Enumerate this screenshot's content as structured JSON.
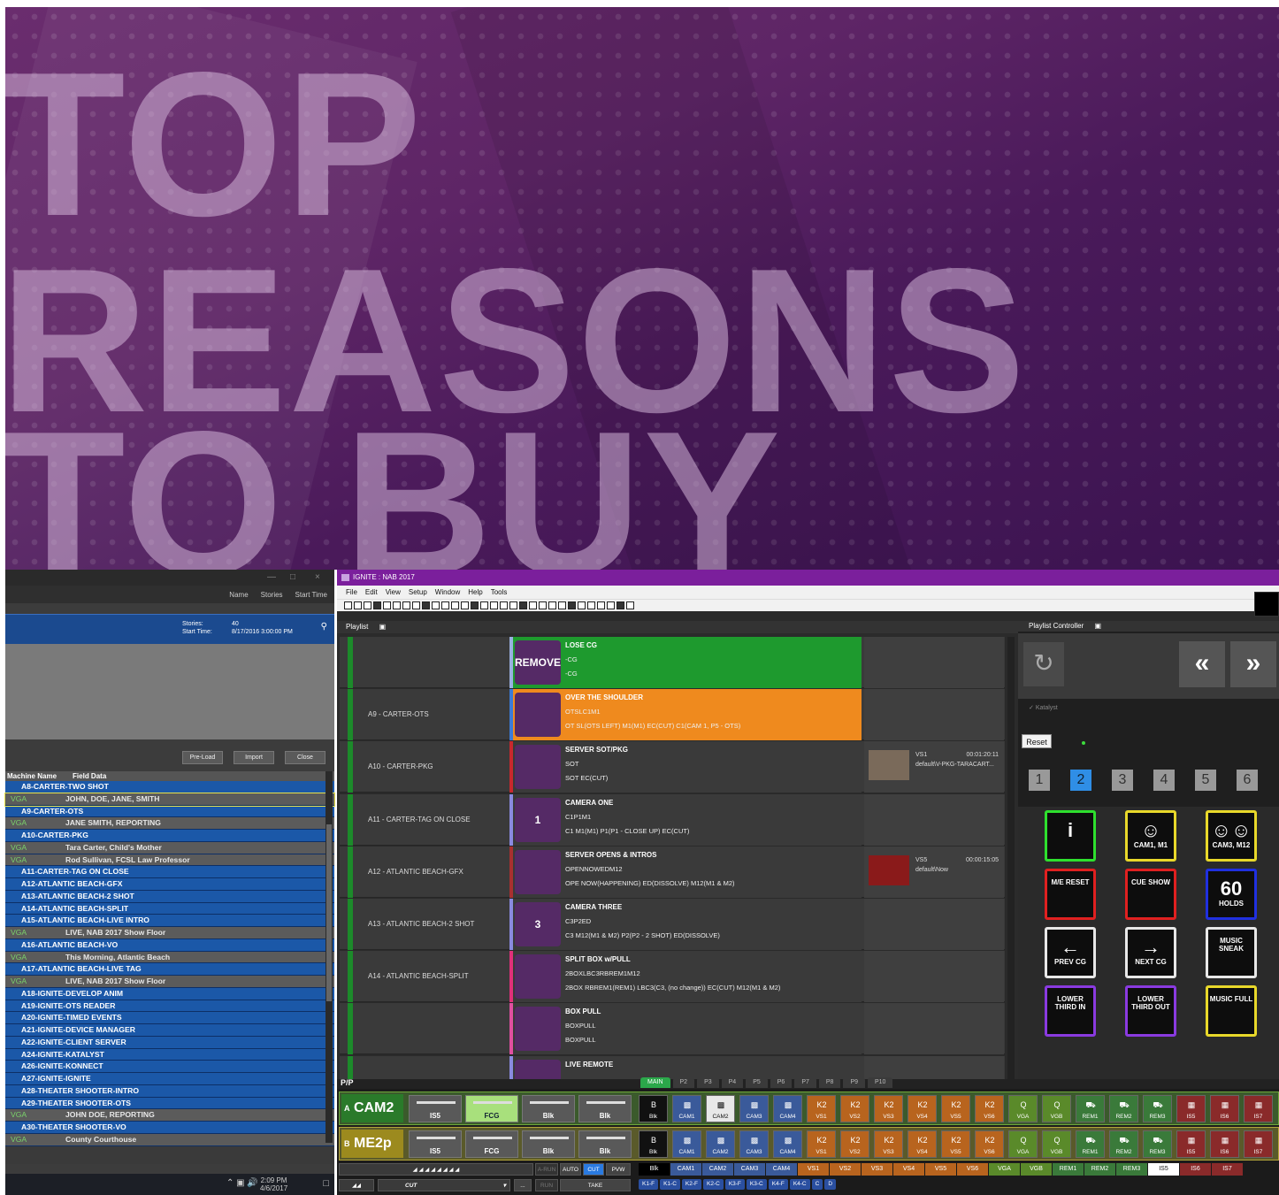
{
  "banner": {
    "line1": "TOP",
    "line2": "REASONS",
    "line3": "TO BUY"
  },
  "left": {
    "win_controls": [
      "—",
      "□",
      "×"
    ],
    "header_cols": [
      "Name",
      "Stories",
      "Start Time"
    ],
    "selected": {
      "stories_label": "Stories:",
      "stories_value": "40",
      "start_label": "Start Time:",
      "start_value": "8/17/2016 3:00:00 PM"
    },
    "buttons": {
      "preload": "Pre-Load",
      "import": "Import",
      "close": "Close"
    },
    "columns": {
      "machine": "Machine Name",
      "field": "Field Data"
    },
    "rows": [
      {
        "type": "blue",
        "text": "A8-CARTER-TWO SHOT"
      },
      {
        "type": "grey",
        "tag": "VGA",
        "text": "JOHN, DOE, JANE, SMITH"
      },
      {
        "type": "blue",
        "text": "A9-CARTER-OTS"
      },
      {
        "type": "grey",
        "tag": "VGA",
        "text": "JANE SMITH, REPORTING"
      },
      {
        "type": "blue",
        "text": "A10-CARTER-PKG"
      },
      {
        "type": "grey",
        "tag": "VGA",
        "text": "Tara Carter, Child's Mother"
      },
      {
        "type": "grey",
        "tag": "VGA",
        "text": "Rod Sullivan, FCSL Law Professor"
      },
      {
        "type": "blue",
        "text": "A11-CARTER-TAG ON CLOSE"
      },
      {
        "type": "blue",
        "text": "A12-ATLANTIC BEACH-GFX"
      },
      {
        "type": "blue",
        "text": "A13-ATLANTIC BEACH-2 SHOT"
      },
      {
        "type": "blue",
        "text": "A14-ATLANTIC BEACH-SPLIT"
      },
      {
        "type": "blue",
        "text": "A15-ATLANTIC BEACH-LIVE INTRO"
      },
      {
        "type": "grey",
        "tag": "VGA",
        "text": "LIVE, NAB 2017 Show Floor"
      },
      {
        "type": "blue",
        "text": "A16-ATLANTIC BEACH-VO"
      },
      {
        "type": "grey",
        "tag": "VGA",
        "text": "This Morning, Atlantic Beach"
      },
      {
        "type": "blue",
        "text": "A17-ATLANTIC BEACH-LIVE TAG"
      },
      {
        "type": "grey",
        "tag": "VGA",
        "text": "LIVE, NAB 2017 Show Floor"
      },
      {
        "type": "blue",
        "text": "A18-IGNITE-DEVELOP ANIM"
      },
      {
        "type": "blue",
        "text": "A19-IGNITE-OTS READER"
      },
      {
        "type": "blue",
        "text": "A20-IGNITE-TIMED EVENTS"
      },
      {
        "type": "blue",
        "text": "A21-IGNITE-DEVICE MANAGER"
      },
      {
        "type": "blue",
        "text": "A22-IGNITE-CLIENT SERVER"
      },
      {
        "type": "blue",
        "text": "A24-IGNITE-KATALYST"
      },
      {
        "type": "blue",
        "text": "A26-IGNITE-KONNECT"
      },
      {
        "type": "blue",
        "text": "A27-IGNITE-IGNITE"
      },
      {
        "type": "blue",
        "text": "A28-THEATER SHOOTER-INTRO"
      },
      {
        "type": "blue",
        "text": "A29-THEATER SHOOTER-OTS"
      },
      {
        "type": "grey",
        "tag": "VGA",
        "text": "JOHN DOE, REPORTING"
      },
      {
        "type": "blue",
        "text": "A30-THEATER SHOOTER-VO"
      },
      {
        "type": "grey",
        "tag": "VGA",
        "text": "County Courthouse"
      }
    ],
    "taskbar": {
      "time": "2:09 PM",
      "date": "4/6/2017"
    }
  },
  "main": {
    "title": "IGNITE : NAB 2017",
    "menu": [
      "File",
      "Edit",
      "View",
      "Setup",
      "Window",
      "Help",
      "Tools"
    ],
    "playlist_label": "Playlist",
    "controller_label": "Playlist Controller",
    "katalyst_label": "Katalyst",
    "reset_label": "Reset",
    "numbers": [
      "1",
      "2",
      "3",
      "4",
      "5",
      "6"
    ],
    "active_number": "2",
    "playlist": [
      {
        "name": "",
        "color": "#9ab0e0",
        "bg": "#1e9a2e",
        "icon": "remove-cg-icon",
        "icon_text": "REMOVE CG",
        "t1": "LOSE CG",
        "t2": "-CG",
        "t3": "-CG",
        "side": null
      },
      {
        "name": "A9 - CARTER-OTS",
        "color": "#3a7ad8",
        "bg": "#ef8a1e",
        "icon": "over-shoulder-icon",
        "icon_text": "",
        "t1": "OVER THE SHOULDER",
        "t2": "OTSLC1M1",
        "t3": "OT SL(OTS LEFT) M1(M1) EC(CUT) C1(CAM 1, P5 - OTS)",
        "side": null
      },
      {
        "name": "A10 - CARTER-PKG",
        "color": "#c8282e",
        "bg": "#3a3a3a",
        "icon": "film-reel-icon",
        "icon_text": "",
        "t1": "SERVER SOT/PKG",
        "t2": "SOT",
        "t3": "SOT EC(CUT)",
        "side": {
          "ch": "VS1",
          "dur": "00:01:20:11",
          "clip": "default\\V-PKG-TARACART...",
          "thumb": "#7a6a5a"
        }
      },
      {
        "name": "A11 - CARTER-TAG ON CLOSE",
        "color": "#8a8ae0",
        "bg": "#3a3a3a",
        "icon": "camera-one-icon",
        "icon_text": "1",
        "t1": "CAMERA ONE",
        "t2": "C1P1M1",
        "t3": "C1 M1(M1) P1(P1 - CLOSE UP) EC(CUT)",
        "side": null
      },
      {
        "name": "A12 - ATLANTIC BEACH-GFX",
        "color": "#a83030",
        "bg": "#3a3a3a",
        "icon": "clapper-icon",
        "icon_text": "",
        "t1": "SERVER OPENS & INTROS",
        "t2": "OPENNOWEDM12",
        "t3": "OPE NOW(HAPPENING) ED(DISSOLVE) M12(M1 & M2)",
        "side": {
          "ch": "VS5",
          "dur": "00:00:15:05",
          "clip": "default\\Now",
          "thumb": "#8a1a1a"
        }
      },
      {
        "name": "A13 - ATLANTIC BEACH-2 SHOT",
        "color": "#8a8ae0",
        "bg": "#3a3a3a",
        "icon": "camera-three-icon",
        "icon_text": "3",
        "t1": "CAMERA THREE",
        "t2": "C3P2ED",
        "t3": "C3 M12(M1 & M2) P2(P2 - 2 SHOT) ED(DISSOLVE)",
        "side": null
      },
      {
        "name": "A14 - ATLANTIC BEACH-SPLIT",
        "color": "#e0307a",
        "bg": "#3a3a3a",
        "icon": "split-box-icon",
        "icon_text": "",
        "t1": "SPLIT BOX w/PULL",
        "t2": "2BOXLBC3RBREM1M12",
        "t3": "2BOX RBREM1(REM1) LBC3(C3, (no change)) EC(CUT) M12(M1 & M2)",
        "side": null
      },
      {
        "name": "",
        "color": "#e04fa0",
        "bg": "#3a3a3a",
        "icon": "box-pull-icon",
        "icon_text": "",
        "t1": "BOX PULL",
        "t2": "BOXPULL",
        "t3": "BOXPULL",
        "side": null
      },
      {
        "name": "",
        "color": "#8a8ae0",
        "bg": "#3a3a3a",
        "icon": "live-remote-icon",
        "icon_text": "",
        "t1": "LIVE REMOTE",
        "t2": "",
        "t3": "",
        "side": null
      }
    ],
    "keys": [
      {
        "label": "",
        "icon": "info-icon",
        "glyph": "i",
        "border": "#2ee02e"
      },
      {
        "label": "CAM1, M1",
        "icon": "person-icon",
        "glyph": "&#9786;",
        "border": "#e8d82a"
      },
      {
        "label": "CAM3, M12",
        "icon": "two-people-icon",
        "glyph": "&#9786;&#9786;",
        "border": "#e8d82a"
      },
      {
        "label": "M/E RESET",
        "icon": "me-reset-icon",
        "glyph": "",
        "border": "#e02020"
      },
      {
        "label": "CUE SHOW",
        "icon": "cue-show-icon",
        "glyph": "",
        "border": "#e02020"
      },
      {
        "label": "HOLDS",
        "icon": "sixty-holds-icon",
        "glyph": "60",
        "border": "#2030e0"
      },
      {
        "label": "PREV CG",
        "icon": "arrow-left-icon",
        "glyph": "&#8592;",
        "border": "#e8e8e8"
      },
      {
        "label": "NEXT CG",
        "icon": "arrow-right-icon",
        "glyph": "&#8594;",
        "border": "#e8e8e8"
      },
      {
        "label": "MUSIC SNEAK",
        "icon": "music-sneak-icon",
        "glyph": "",
        "border": "#e8e8e8"
      },
      {
        "label": "LOWER THIRD IN",
        "icon": "lower-third-in-icon",
        "glyph": "",
        "border": "#8a3ae0"
      },
      {
        "label": "LOWER THIRD OUT",
        "icon": "lower-third-out-icon",
        "glyph": "",
        "border": "#8a3ae0"
      },
      {
        "label": "MUSIC FULL",
        "icon": "music-full-icon",
        "glyph": "",
        "border": "#e8d82a"
      }
    ],
    "pp": {
      "label": "P/P",
      "tabs": [
        "MAIN",
        "P2",
        "P3",
        "P4",
        "P5",
        "P6",
        "P7",
        "P8",
        "P9",
        "P10"
      ],
      "busA": {
        "letter": "A",
        "name": "CAM2"
      },
      "busB": {
        "letter": "B",
        "name": "ME2p"
      },
      "keyersA": [
        "IS5",
        "FCG",
        "Blk",
        "Blk"
      ],
      "keyersB": [
        "IS5",
        "FCG",
        "Blk",
        "Blk"
      ],
      "sources": [
        "Blk",
        "CAM1",
        "CAM2",
        "CAM3",
        "CAM4",
        "VS1",
        "VS2",
        "VS3",
        "VS4",
        "VS5",
        "VS6",
        "VGA",
        "VGB",
        "REM1",
        "REM2",
        "REM3",
        "IS5",
        "IS6",
        "IS7"
      ],
      "row3": [
        "Blk",
        "CAM1",
        "CAM2",
        "CAM3",
        "CAM4",
        "VS1",
        "VS2",
        "VS3",
        "VS4",
        "VS5",
        "VS6",
        "VGA",
        "VGB",
        "REM1",
        "REM2",
        "REM3",
        "IS5",
        "IS6",
        "IS7"
      ],
      "transition": {
        "arun": "A-RUN",
        "auto": "AUTO",
        "cut": "CUT",
        "pvw": "PVW",
        "run": "RUN",
        "take": "TAKE",
        "mode": "CUT"
      },
      "keybuttons": [
        "K1-F",
        "K1-C",
        "K2-F",
        "K2-C",
        "K3-F",
        "K3-C",
        "K4-F",
        "K4-C",
        "C",
        "D"
      ]
    }
  }
}
